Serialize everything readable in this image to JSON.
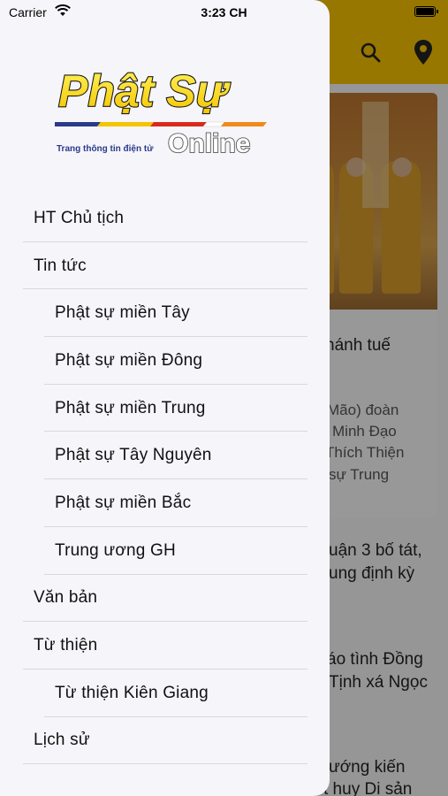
{
  "status_bar": {
    "carrier": "Carrier",
    "time": "3:23 CH",
    "battery_level": 1.0
  },
  "logo": {
    "brand_title": "Phật Sự",
    "tagline": "Trang thông tin điện tử",
    "brand_online": "Online"
  },
  "menu": {
    "items": [
      {
        "label": "HT Chủ tịch",
        "level": "top"
      },
      {
        "label": "Tin tức",
        "level": "top"
      },
      {
        "label": "Phật sự miền Tây",
        "level": "sub"
      },
      {
        "label": "Phật sự miền Đông",
        "level": "sub"
      },
      {
        "label": "Phật sự miền Trung",
        "level": "sub"
      },
      {
        "label": "Phật sự Tây Nguyên",
        "level": "sub"
      },
      {
        "label": "Phật sự miền Bắc",
        "level": "sub"
      },
      {
        "label": "Trung ương GH",
        "level": "sub"
      },
      {
        "label": "Văn bản",
        "level": "top"
      },
      {
        "label": "Từ thiện",
        "level": "top"
      },
      {
        "label": "Từ thiện Kiên Giang",
        "level": "sub"
      },
      {
        "label": "Lịch sử",
        "level": "top"
      }
    ]
  },
  "background": {
    "header_icons": [
      "search-icon",
      "location-pin-icon"
    ],
    "snippets": [
      "hánh tuế",
      "Mão) đoàn",
      "Minh Đạo",
      "Thích Thiện",
      "sự Trung",
      "uận 3 bố tát,",
      "ung định kỳ",
      "áo tình Đồng",
      "Tịnh xá Ngọc",
      "ướng kiến",
      "t huy Di sản"
    ]
  },
  "colors": {
    "brand_yellow": "#f6c100",
    "drawer_bg": "#f6f5fa",
    "separator": "#d9d8de"
  }
}
